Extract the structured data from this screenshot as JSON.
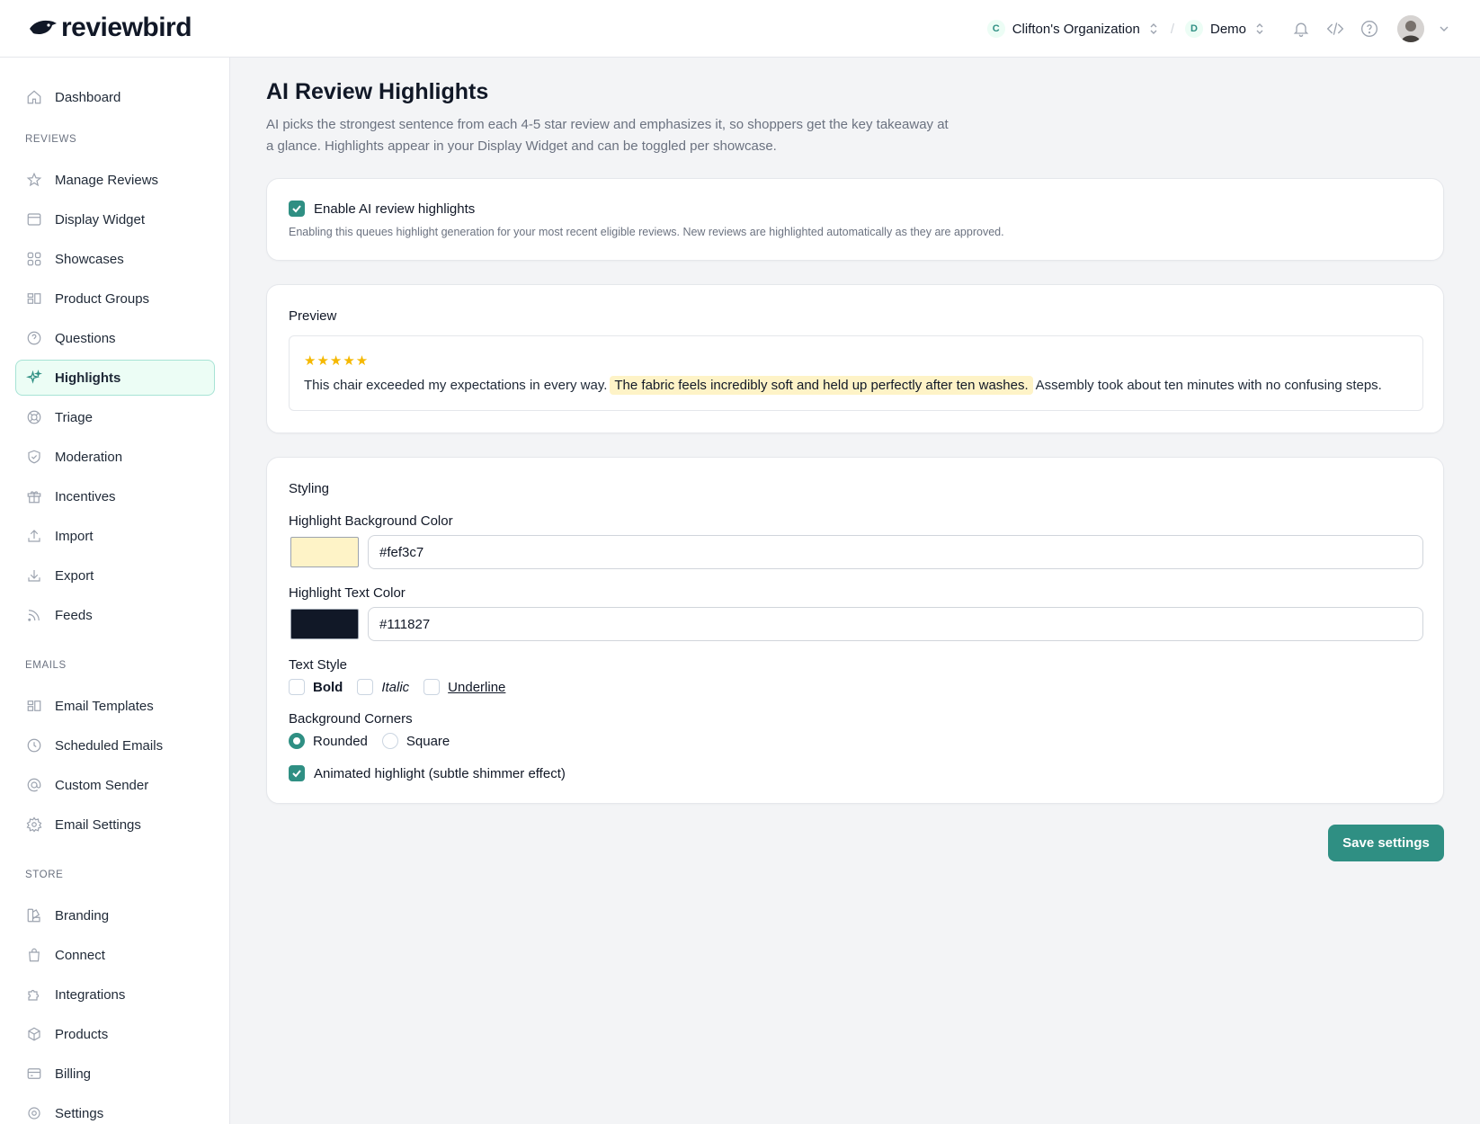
{
  "app": {
    "brand": "reviewbird"
  },
  "header": {
    "org": {
      "badge": "C",
      "name": "Clifton's Organization"
    },
    "separator": "/",
    "project": {
      "badge": "D",
      "name": "Demo"
    },
    "icons": [
      "bell-icon",
      "code-icon",
      "help-icon",
      "user-avatar"
    ]
  },
  "sidebar": {
    "dashboard": "Dashboard",
    "sections": {
      "reviews": "REVIEWS",
      "emails": "EMAILS",
      "store": "STORE"
    },
    "reviews_items": [
      "Manage Reviews",
      "Display Widget",
      "Showcases",
      "Product Groups",
      "Questions",
      "Highlights",
      "Triage",
      "Moderation",
      "Incentives",
      "Import",
      "Export",
      "Feeds"
    ],
    "emails_items": [
      "Email Templates",
      "Scheduled Emails",
      "Custom Sender",
      "Email Settings"
    ],
    "store_items": [
      "Branding",
      "Connect",
      "Integrations",
      "Products",
      "Billing",
      "Settings"
    ],
    "active": "Highlights"
  },
  "page": {
    "title": "AI Review Highlights",
    "description": "AI picks the strongest sentence from each 4-5 star review and emphasizes it, so shoppers get the key takeaway at a glance. Highlights appear in your Display Widget and can be toggled per showcase."
  },
  "enable_card": {
    "label": "Enable AI review highlights",
    "checked": true,
    "help": "Enabling this queues highlight generation for your most recent eligible reviews. New reviews are highlighted automatically as they are approved."
  },
  "preview": {
    "title": "Preview",
    "stars": "★★★★★",
    "rating": 5,
    "text_before": "This chair exceeded my expectations in every way.",
    "text_highlight": "The fabric feels incredibly soft and held up perfectly after ten washes.",
    "text_after": "Assembly took about ten minutes with no confusing steps."
  },
  "styling": {
    "title": "Styling",
    "bg_color_label": "Highlight Background Color",
    "bg_color_value": "#fef3c7",
    "text_color_label": "Highlight Text Color",
    "text_color_value": "#111827",
    "text_style_label": "Text Style",
    "text_style_options": [
      {
        "label": "Bold",
        "checked": false
      },
      {
        "label": "Italic",
        "checked": false
      },
      {
        "label": "Underline",
        "checked": false
      }
    ],
    "corners_label": "Background Corners",
    "corners_options": [
      {
        "label": "Rounded",
        "selected": true
      },
      {
        "label": "Square",
        "selected": false
      }
    ],
    "animated_label": "Animated highlight (subtle shimmer effect)",
    "animated_checked": true
  },
  "actions": {
    "save": "Save settings"
  },
  "colors": {
    "accent": "#2f8f83",
    "highlight_bg": "#fef3c7",
    "star": "#f5b800"
  }
}
